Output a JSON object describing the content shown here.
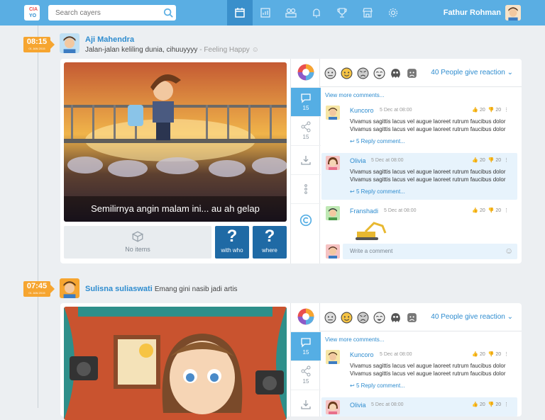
{
  "header": {
    "logo_top": "CIA",
    "logo_bottom": "YO",
    "search_placeholder": "Search cayers",
    "user_name": "Fathur Rohman",
    "nav": [
      "calendar-icon",
      "chart-icon",
      "people-icon",
      "bell-icon",
      "trophy-icon",
      "store-icon",
      "gear-icon"
    ]
  },
  "posts": [
    {
      "time": "08:15",
      "date": "01 JAN 2015",
      "author": "Aji Mahendra",
      "status": "Jalan-jalan keliling dunia, cihuuyyyy",
      "mood": "- Feeling Happy",
      "caption": "Semilirnya angin malam ini... au ah gelap",
      "no_items": "No items",
      "with_who": "with who",
      "where": "where",
      "comments_count": "15",
      "shares_count": "15",
      "reaction_link": "40 People give reaction",
      "view_more": "View more comments...",
      "comments": [
        {
          "name": "Kuncoro",
          "time": "5 Dec at 08:00",
          "likes": "20",
          "dislikes": "20",
          "text": "Vivamus sagittis lacus vel augue laoreet rutrum faucibus dolor Vivamus sagittis lacus vel augue laoreet rutrum faucibus dolor",
          "reply": "5 Reply comment..."
        },
        {
          "name": "Olivia",
          "time": "5 Dec at 08:00",
          "likes": "20",
          "dislikes": "20",
          "text": "Vivamus sagittis lacus vel augue laoreet rutrum faucibus dolor Vivamus sagittis lacus vel augue laoreet rutrum faucibus dolor",
          "reply": "5 Reply comment..."
        },
        {
          "name": "Franshadi",
          "time": "5 Dec at 08:00",
          "likes": "20",
          "dislikes": "20"
        }
      ],
      "write_placeholder": "Write a comment"
    },
    {
      "time": "07:45",
      "date": "01 JAN 2015",
      "author": "Sulisna suliaswati",
      "status": "Emang gini nasib jadi artis",
      "comments_count": "15",
      "shares_count": "15",
      "reaction_link": "40 People give reaction",
      "view_more": "View more comments...",
      "comments": [
        {
          "name": "Kuncoro",
          "time": "5 Dec at 08:00",
          "likes": "20",
          "dislikes": "20",
          "text": "Vivamus sagittis lacus vel augue laoreet rutrum faucibus dolor Vivamus sagittis lacus vel augue laoreet rutrum faucibus dolor",
          "reply": "5 Reply comment..."
        },
        {
          "name": "Olivia",
          "time": "5 Dec at 08:00",
          "likes": "20",
          "dislikes": "20"
        }
      ]
    }
  ]
}
